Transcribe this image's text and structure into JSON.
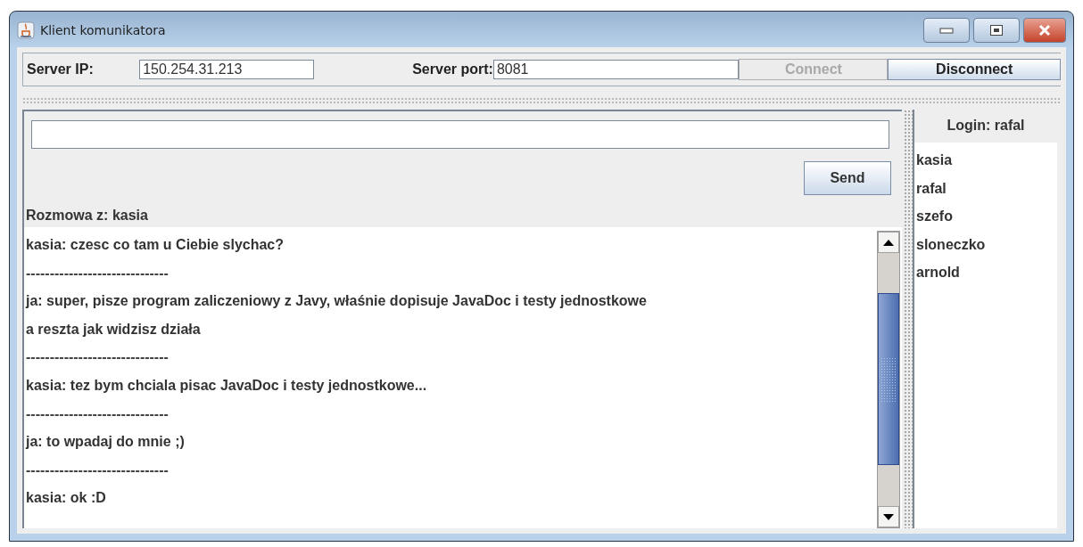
{
  "window": {
    "title": "Klient komunikatora"
  },
  "connection": {
    "ip_label": "Server IP:",
    "ip_value": "150.254.31.213",
    "port_label": "Server port:",
    "port_value": "8081",
    "buttons": [
      {
        "label": "Connect",
        "disabled": true
      },
      {
        "label": "Disconnect",
        "disabled": false
      }
    ]
  },
  "compose": {
    "send": "Send"
  },
  "conversation": {
    "title": "Rozmowa z: kasia",
    "lines": [
      {
        "kind": "message",
        "text": "kasia: czesc co tam u Ciebie slychac?"
      },
      {
        "kind": "separator",
        "text": "------------------------------"
      },
      {
        "kind": "message",
        "text": "ja: super, pisze program zaliczeniowy z Javy, właśnie dopisuje JavaDoc i testy jednostkowe"
      },
      {
        "kind": "message",
        "text": "a reszta jak widzisz działa"
      },
      {
        "kind": "separator",
        "text": "------------------------------"
      },
      {
        "kind": "message",
        "text": "kasia: tez bym chciala pisac JavaDoc i testy jednostkowe..."
      },
      {
        "kind": "separator",
        "text": "------------------------------"
      },
      {
        "kind": "message",
        "text": "ja: to wpadaj do mnie ;)"
      },
      {
        "kind": "separator",
        "text": "------------------------------"
      },
      {
        "kind": "message",
        "text": "kasia: ok :D"
      }
    ]
  },
  "users": {
    "title": "Login: rafal",
    "items": [
      "kasia",
      "rafal",
      "szefo",
      "sloneczko",
      "arnold"
    ]
  }
}
